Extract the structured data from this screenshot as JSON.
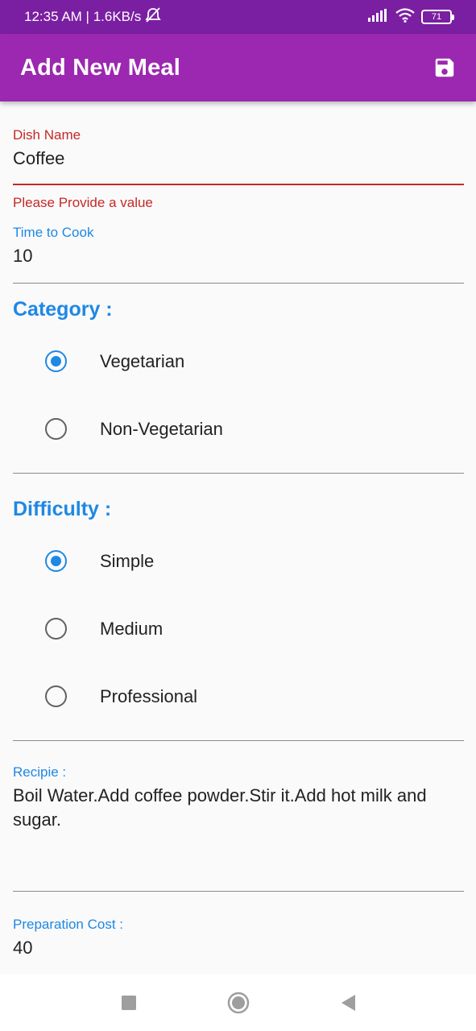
{
  "status_bar": {
    "time_speed": "12:35 AM | 1.6KB/s",
    "battery": "71"
  },
  "app_bar": {
    "title": "Add New Meal"
  },
  "form": {
    "dish_name": {
      "label": "Dish Name",
      "value": "Coffee",
      "error": "Please Provide a value"
    },
    "time_to_cook": {
      "label": "Time to Cook",
      "value": "10"
    },
    "category": {
      "title": "Category :",
      "options": [
        {
          "label": "Vegetarian",
          "checked": true
        },
        {
          "label": "Non-Vegetarian",
          "checked": false
        }
      ]
    },
    "difficulty": {
      "title": "Difficulty :",
      "options": [
        {
          "label": "Simple",
          "checked": true
        },
        {
          "label": "Medium",
          "checked": false
        },
        {
          "label": "Professional",
          "checked": false
        }
      ]
    },
    "recipe": {
      "label": "Recipie :",
      "value": "Boil Water.Add coffee powder.Stir it.Add hot milk and sugar."
    },
    "preparation_cost": {
      "label": "Preparation Cost :",
      "value": "40"
    }
  },
  "colors": {
    "status_bar": "#7b1fa2",
    "app_bar": "#9c27b0",
    "accent": "#1e88e5",
    "error": "#c62828"
  },
  "icons": {
    "save": "save-icon",
    "nav_recents": "square-icon",
    "nav_home": "circle-icon",
    "nav_back": "triangle-back-icon"
  }
}
